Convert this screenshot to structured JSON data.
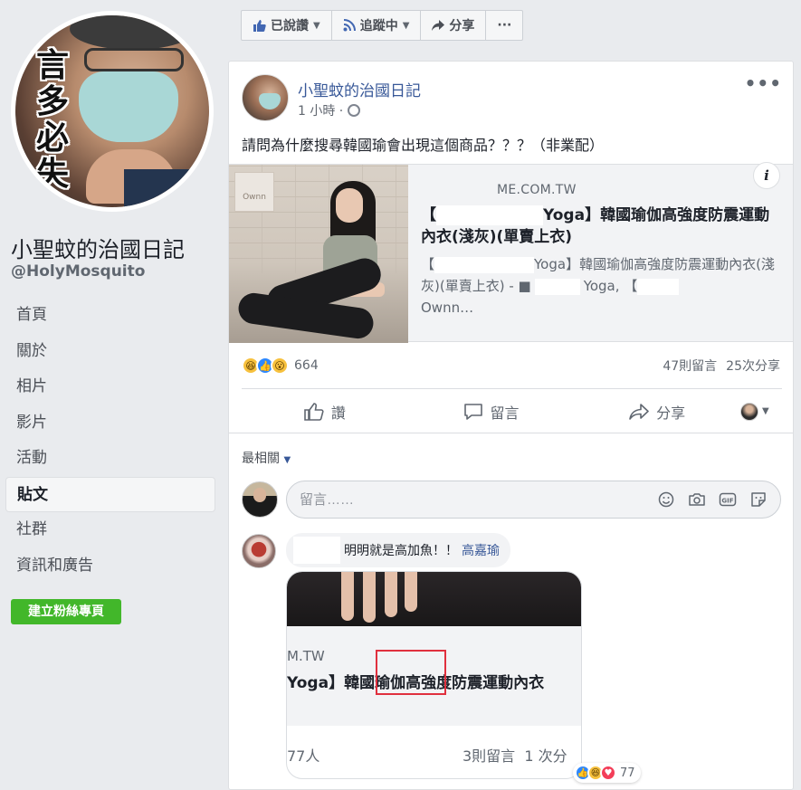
{
  "sidebar": {
    "profile_text": "言多必失",
    "page_name": "小聖蚊的治國日記",
    "handle": "@HolyMosquito",
    "nav": [
      "首頁",
      "關於",
      "相片",
      "影片",
      "活動",
      "貼文",
      "社群",
      "資訊和廣告"
    ],
    "active_index": 5,
    "create_button": "建立粉絲專頁"
  },
  "toolbar": {
    "liked": "已說讚",
    "following": "追蹤中",
    "share": "分享",
    "more": "···"
  },
  "post": {
    "author": "小聖蚊的治國日記",
    "time": "1 小時 ·",
    "text": "請問為什麼搜尋韓國瑜會出現這個商品？？？（非業配）",
    "link": {
      "logo": "Ownn",
      "domain": "ME.COM.TW",
      "title_prefix": "【",
      "title_rest": "Yoga】韓國瑜伽高強度防震運動內衣(淺灰)(單賣上衣)",
      "desc_1": "Yoga】韓國瑜伽高強度防震運動內衣(淺灰)(單賣上衣) - ■",
      "desc_2": "Yoga, 【",
      "desc_3": "Ownn…",
      "info": "i"
    },
    "reaction_count": "664",
    "comments": "47則留言",
    "shares": "25次分享",
    "actions": {
      "like": "讚",
      "comment": "留言",
      "share": "分享"
    },
    "sort_label": "最相關"
  },
  "comment_box": {
    "placeholder": "留言……"
  },
  "comment": {
    "text": "明明就是高加魚！！",
    "mention": "高嘉瑜",
    "attachment": {
      "domain": "M.TW",
      "title": "Yoga】韓國瑜伽高強度防震運動內衣",
      "reactions": "77人",
      "comments": "3則留言",
      "shares": "1 次分"
    },
    "reaction_count": "77"
  },
  "colors": {
    "background": "#e9ebee",
    "link": "#385898",
    "green": "#42b72a"
  }
}
